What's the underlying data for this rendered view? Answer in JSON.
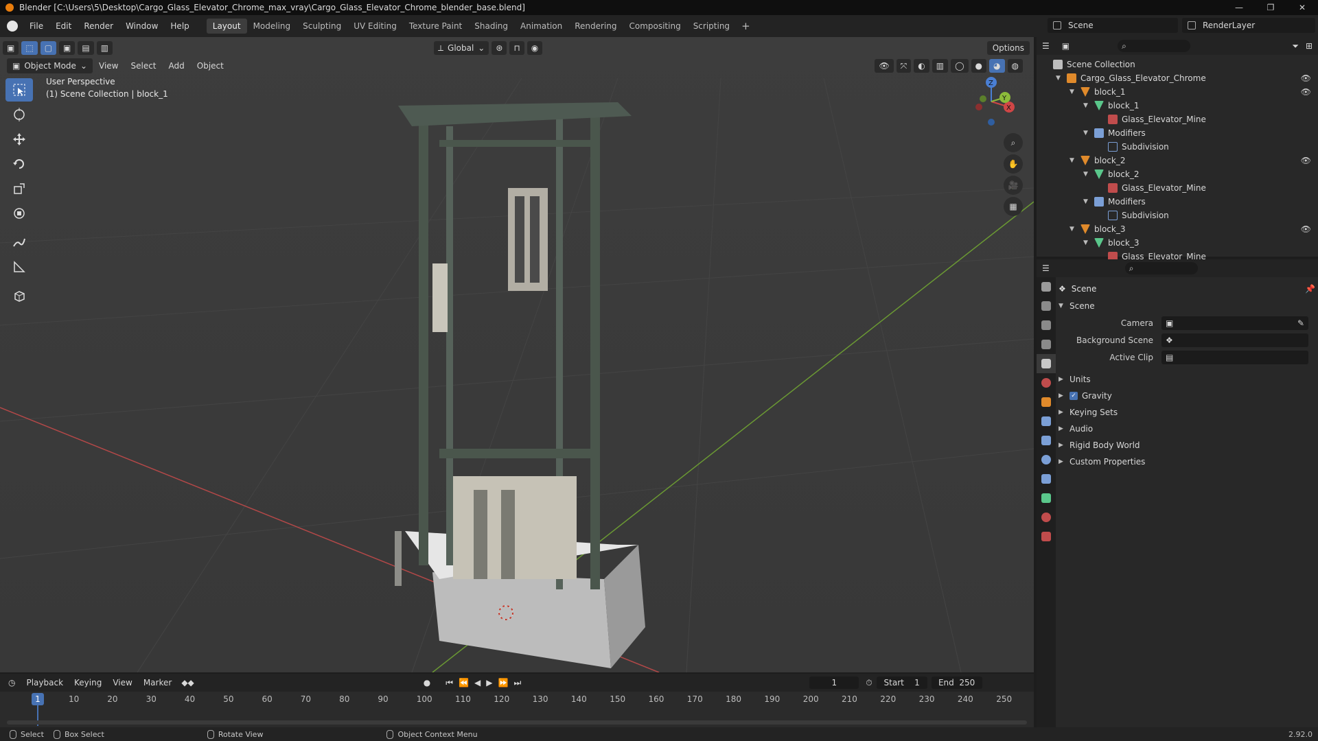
{
  "window": {
    "title": "Blender [C:\\Users\\5\\Desktop\\Cargo_Glass_Elevator_Chrome_max_vray\\Cargo_Glass_Elevator_Chrome_blender_base.blend]",
    "minimize": "—",
    "maximize": "❐",
    "close": "✕"
  },
  "menu": {
    "items": [
      "File",
      "Edit",
      "Render",
      "Window",
      "Help"
    ],
    "workspaces": [
      "Layout",
      "Modeling",
      "Sculpting",
      "UV Editing",
      "Texture Paint",
      "Shading",
      "Animation",
      "Rendering",
      "Compositing",
      "Scripting"
    ],
    "add_tab": "+",
    "scene": "Scene",
    "render_layer": "RenderLayer"
  },
  "viewport": {
    "mode": "Object Mode",
    "menus": [
      "View",
      "Select",
      "Add",
      "Object"
    ],
    "orientation": "Global",
    "options": "Options",
    "info_line1": "User Perspective",
    "info_line2": "(1) Scene Collection | block_1",
    "gizmo_z": "Z",
    "gizmo_y": "Y",
    "gizmo_x": "X"
  },
  "outliner": {
    "rows": [
      {
        "label": "Scene Collection",
        "icon": "scene-collection-icon",
        "depth": 0,
        "arrow": "",
        "eye": false
      },
      {
        "label": "Cargo_Glass_Elevator_Chrome",
        "icon": "empty-icon",
        "depth": 1,
        "arrow": "▼",
        "eye": true
      },
      {
        "label": "block_1",
        "icon": "object-icon",
        "depth": 2,
        "arrow": "▼",
        "eye": true
      },
      {
        "label": "block_1",
        "icon": "mesh-icon",
        "depth": 3,
        "arrow": "▼",
        "eye": false
      },
      {
        "label": "Glass_Elevator_Mine",
        "icon": "material-icon",
        "depth": 4,
        "arrow": "",
        "eye": false
      },
      {
        "label": "Modifiers",
        "icon": "modifier-icon",
        "depth": 3,
        "arrow": "▼",
        "eye": false
      },
      {
        "label": "Subdivision",
        "icon": "subdivision-icon",
        "depth": 4,
        "arrow": "",
        "eye": false
      },
      {
        "label": "block_2",
        "icon": "object-icon",
        "depth": 2,
        "arrow": "▼",
        "eye": true
      },
      {
        "label": "block_2",
        "icon": "mesh-icon",
        "depth": 3,
        "arrow": "▼",
        "eye": false
      },
      {
        "label": "Glass_Elevator_Mine",
        "icon": "material-icon",
        "depth": 4,
        "arrow": "",
        "eye": false
      },
      {
        "label": "Modifiers",
        "icon": "modifier-icon",
        "depth": 3,
        "arrow": "▼",
        "eye": false
      },
      {
        "label": "Subdivision",
        "icon": "subdivision-icon",
        "depth": 4,
        "arrow": "",
        "eye": false
      },
      {
        "label": "block_3",
        "icon": "object-icon",
        "depth": 2,
        "arrow": "▼",
        "eye": true
      },
      {
        "label": "block_3",
        "icon": "mesh-icon",
        "depth": 3,
        "arrow": "▼",
        "eye": false
      },
      {
        "label": "Glass_Elevator_Mine",
        "icon": "material-icon",
        "depth": 4,
        "arrow": "",
        "eye": false
      }
    ]
  },
  "properties": {
    "context": "Scene",
    "panel": "Scene",
    "fields": [
      {
        "label": "Camera",
        "value": ""
      },
      {
        "label": "Background Scene",
        "value": ""
      },
      {
        "label": "Active Clip",
        "value": ""
      }
    ],
    "subpanels": [
      "Units",
      "Gravity",
      "Keying Sets",
      "Audio",
      "Rigid Body World",
      "Custom Properties"
    ]
  },
  "timeline": {
    "menus": [
      "Playback",
      "Keying",
      "View",
      "Marker"
    ],
    "current_frame": "1",
    "start_label": "Start",
    "start": "1",
    "end_label": "End",
    "end": "250",
    "ticks": [
      "10",
      "20",
      "30",
      "40",
      "50",
      "60",
      "70",
      "80",
      "90",
      "100",
      "110",
      "120",
      "130",
      "140",
      "150",
      "160",
      "170",
      "180",
      "190",
      "200",
      "210",
      "220",
      "230",
      "240",
      "250"
    ],
    "cursor": "1"
  },
  "status": {
    "select": "Select",
    "box_select": "Box Select",
    "rotate_view": "Rotate View",
    "context_menu": "Object Context Menu",
    "version": "2.92.0"
  },
  "colors": {
    "accent": "#4772b3",
    "grid_x": "#b34848",
    "grid_y": "#6b9a33"
  }
}
